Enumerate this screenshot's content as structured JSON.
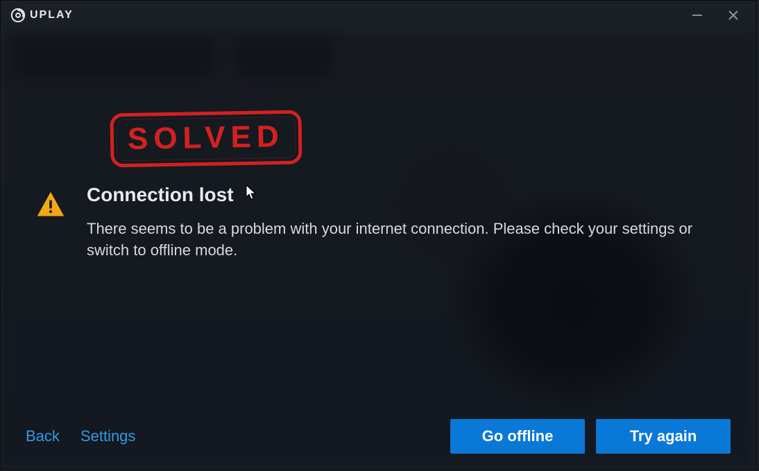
{
  "titlebar": {
    "app_name": "UPLAY"
  },
  "overlay": {
    "stamp_text": "SOLVED"
  },
  "error": {
    "title": "Connection lost",
    "body": "There seems to be a problem with your internet connection. Please check your settings or switch to offline mode."
  },
  "footer": {
    "back_label": "Back",
    "settings_label": "Settings",
    "go_offline_label": "Go offline",
    "try_again_label": "Try again"
  },
  "icons": {
    "warning": "warning-icon",
    "logo": "uplay-logo-icon",
    "minimize": "minimize-icon",
    "close": "close-icon",
    "cursor": "cursor-icon"
  },
  "colors": {
    "accent": "#0a78d6",
    "link": "#2e9be6",
    "warning": "#f2a815",
    "stamp": "#d32121"
  }
}
